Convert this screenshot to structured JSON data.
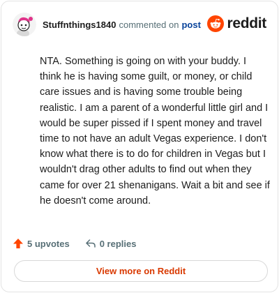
{
  "comment": {
    "username": "Stuffnthings1840",
    "action": "commented on",
    "post_link": "post",
    "body": "NTA. Something is going on with your buddy. I think he is having some guilt, or money, or child care issues and is having some trouble being realistic. I am a parent of a wonderful little girl and I would be super pissed if I spent money and travel time to not have an adult Vegas experience. I don't know what there is to do for children in Vegas but I wouldn't drag other adults to find out when they came for over 21 shenanigans. Wait a bit and see if he doesn't come around."
  },
  "brand": {
    "wordmark": "reddit",
    "color": "#ff4500"
  },
  "footer": {
    "upvotes": "5 upvotes",
    "replies": "0 replies",
    "upvote_icon": "arrow-up-icon",
    "reply_icon": "reply-icon"
  },
  "cta": {
    "label": "View more on Reddit",
    "color": "#d93900"
  }
}
